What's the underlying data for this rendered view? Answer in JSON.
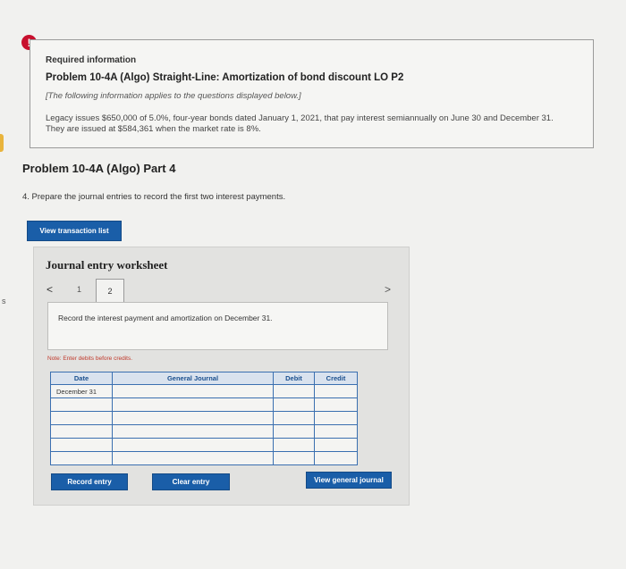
{
  "alert_icon_glyph": "!",
  "edge_letter": "s",
  "info": {
    "required_label": "Required information",
    "problem_title": "Problem 10-4A (Algo) Straight-Line: Amortization of bond discount LO P2",
    "applies_note": "[The following information applies to the questions displayed below.]",
    "body_text": "Legacy issues $650,000 of 5.0%, four-year bonds dated January 1, 2021, that pay interest semiannually on June 30 and December 31. They are issued at $584,361 when the market rate is 8%."
  },
  "part_title": "Problem 10-4A (Algo) Part 4",
  "question": "4. Prepare the journal entries to record the first two interest payments.",
  "buttons": {
    "view_transaction_list": "View transaction list",
    "record_entry": "Record entry",
    "clear_entry": "Clear entry",
    "view_general_journal": "View general journal"
  },
  "worksheet": {
    "title": "Journal entry worksheet",
    "prev_glyph": "<",
    "next_glyph": ">",
    "tabs": [
      "1",
      "2"
    ],
    "active_tab": "2",
    "instruction": "Record the interest payment and amortization on December 31.",
    "note": "Note: Enter debits before credits.",
    "columns": [
      "Date",
      "General Journal",
      "Debit",
      "Credit"
    ],
    "rows": [
      {
        "date": "December 31",
        "account": "",
        "debit": "",
        "credit": ""
      },
      {
        "date": "",
        "account": "",
        "debit": "",
        "credit": ""
      },
      {
        "date": "",
        "account": "",
        "debit": "",
        "credit": ""
      },
      {
        "date": "",
        "account": "",
        "debit": "",
        "credit": ""
      },
      {
        "date": "",
        "account": "",
        "debit": "",
        "credit": ""
      },
      {
        "date": "",
        "account": "",
        "debit": "",
        "credit": ""
      }
    ]
  },
  "colors": {
    "accent_blue": "#1a5ea8",
    "alert_red": "#c8102e",
    "table_border": "#3a6fb0"
  }
}
